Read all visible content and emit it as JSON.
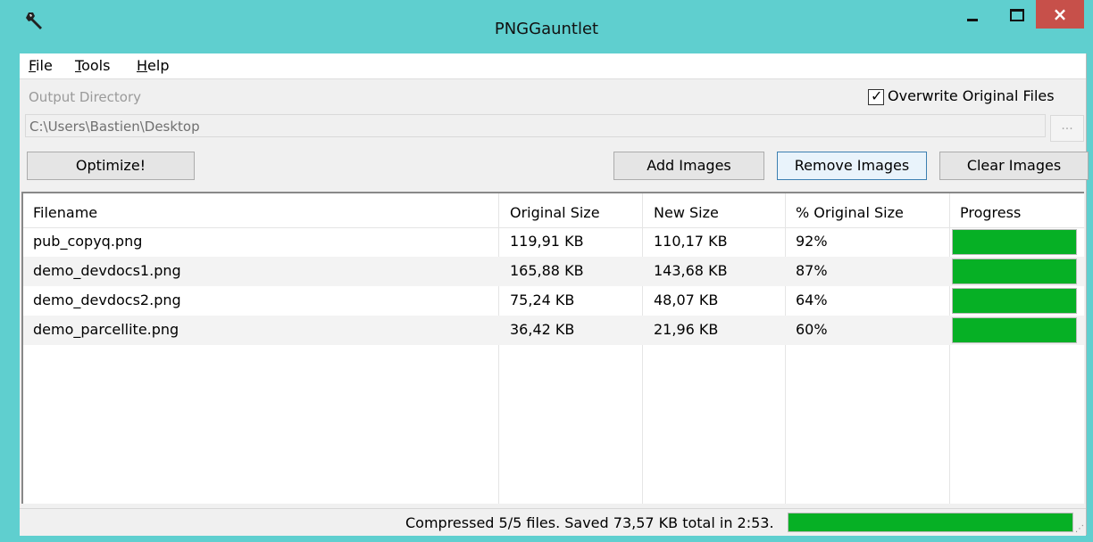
{
  "window": {
    "title": "PNGGauntlet",
    "close_glyph": "×",
    "icon": "wrench-icon"
  },
  "menu": [
    {
      "mnemonic": "F",
      "rest": "ile"
    },
    {
      "mnemonic": "T",
      "rest": "ools"
    },
    {
      "mnemonic": "H",
      "rest": "elp"
    }
  ],
  "output": {
    "label": "Output Directory",
    "value": "C:\\Users\\Bastien\\Desktop",
    "browse_label": "...",
    "overwrite_label": "Overwrite Original Files",
    "overwrite_checked": true
  },
  "buttons": {
    "optimize": "Optimize!",
    "add": "Add Images",
    "remove": "Remove Images",
    "clear": "Clear Images"
  },
  "table": {
    "columns": [
      "Filename",
      "Original Size",
      "New Size",
      "% Original Size",
      "Progress"
    ],
    "rows": [
      {
        "filename": "pub_copyq.png",
        "original": "119,91 KB",
        "new": "110,17 KB",
        "percent": "92%",
        "progress": 1.0
      },
      {
        "filename": "demo_devdocs1.png",
        "original": "165,88 KB",
        "new": "143,68 KB",
        "percent": "87%",
        "progress": 1.0
      },
      {
        "filename": "demo_devdocs2.png",
        "original": "75,24 KB",
        "new": "48,07 KB",
        "percent": "64%",
        "progress": 1.0
      },
      {
        "filename": "demo_parcellite.png",
        "original": "36,42 KB",
        "new": "21,96 KB",
        "percent": "60%",
        "progress": 1.0
      }
    ]
  },
  "status": {
    "text": "Compressed 5/5 files. Saved 73,57 KB total in 2:53.",
    "progress": 1.0
  },
  "colors": {
    "accent": "#5fcfcf",
    "progress": "#06b025",
    "close": "#c7504a"
  }
}
